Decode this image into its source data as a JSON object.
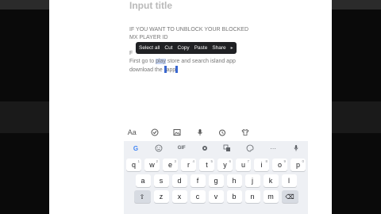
{
  "editor": {
    "title_placeholder": "Input title",
    "lines": {
      "l1": "IF YOU WANT TO UNBLOCK YOUR BLOCKED",
      "l2": "MX PLAYER ID",
      "l3a": "F",
      "l3b": "",
      "l4a": "First go to ",
      "l4b": "play",
      "l4c": " store and search island app",
      "l5a": "download",
      "l5b": " the ",
      "l5c": "app"
    }
  },
  "selection_toolbar": {
    "select_all": "Select all",
    "cut": "Cut",
    "copy": "Copy",
    "paste": "Paste",
    "share": "Share",
    "more": "▸"
  },
  "format_bar": {
    "text_format_label": "Aa",
    "icons": [
      "text-format-icon",
      "checkbox-icon",
      "image-icon",
      "microphone-icon",
      "alarm-icon",
      "shirt-icon"
    ]
  },
  "keyboard": {
    "toolbar": {
      "google": "G",
      "gif": "GIF",
      "more": "···"
    },
    "row1": [
      "q",
      "w",
      "e",
      "r",
      "t",
      "y",
      "u",
      "i",
      "o",
      "p"
    ],
    "row1_hints": [
      "1",
      "2",
      "3",
      "4",
      "5",
      "6",
      "7",
      "8",
      "9",
      "0"
    ],
    "row2": [
      "a",
      "s",
      "d",
      "f",
      "g",
      "h",
      "j",
      "k",
      "l"
    ],
    "row3": [
      "z",
      "x",
      "c",
      "v",
      "b",
      "n",
      "m"
    ],
    "shift": "⇧",
    "backspace": "⌫"
  }
}
